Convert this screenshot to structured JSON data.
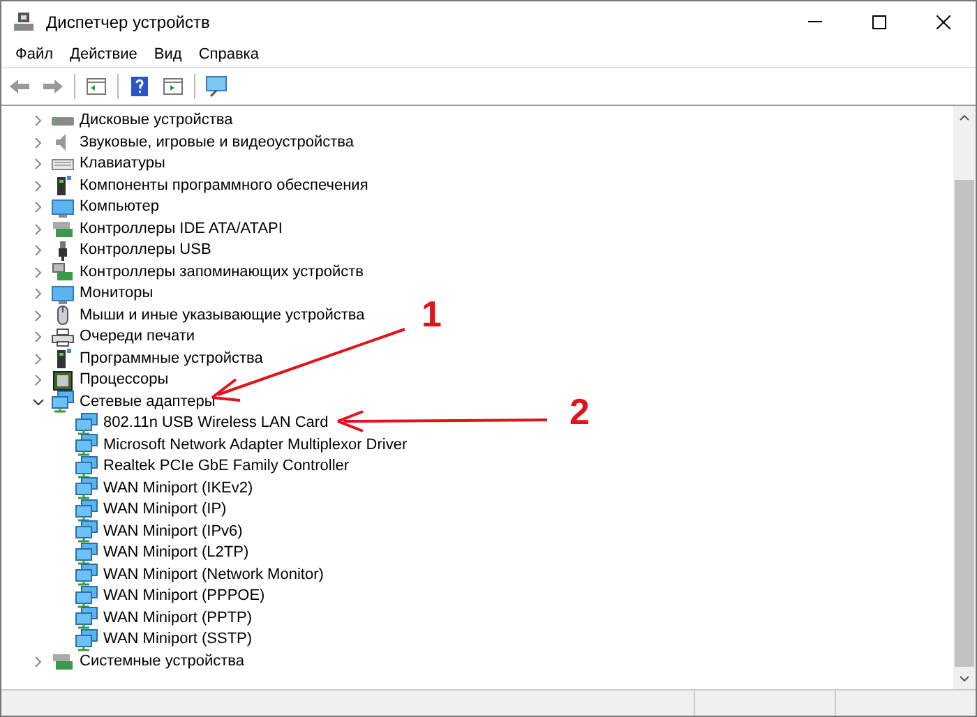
{
  "window": {
    "title": "Диспетчер устройств"
  },
  "menu": [
    "Файл",
    "Действие",
    "Вид",
    "Справка"
  ],
  "tree": [
    {
      "label": "Дисковые устройства",
      "kind": "disk",
      "expanded": false
    },
    {
      "label": "Звуковые, игровые и видеоустройства",
      "kind": "sound",
      "expanded": false
    },
    {
      "label": "Клавиатуры",
      "kind": "keyboard",
      "expanded": false
    },
    {
      "label": "Компоненты программного обеспечения",
      "kind": "software",
      "expanded": false
    },
    {
      "label": "Компьютер",
      "kind": "monitor",
      "expanded": false
    },
    {
      "label": "Контроллеры IDE ATA/ATAPI",
      "kind": "board",
      "expanded": false
    },
    {
      "label": "Контроллеры USB",
      "kind": "usb",
      "expanded": false
    },
    {
      "label": "Контроллеры запоминающих устройств",
      "kind": "storage",
      "expanded": false
    },
    {
      "label": "Мониторы",
      "kind": "monitor",
      "expanded": false
    },
    {
      "label": "Мыши и иные указывающие устройства",
      "kind": "mouse",
      "expanded": false
    },
    {
      "label": "Очереди печати",
      "kind": "printer",
      "expanded": false
    },
    {
      "label": "Программные устройства",
      "kind": "software",
      "expanded": false
    },
    {
      "label": "Процессоры",
      "kind": "cpu",
      "expanded": false
    },
    {
      "label": "Сетевые адаптеры",
      "kind": "network",
      "expanded": true,
      "children": [
        {
          "label": "802.11n USB Wireless LAN Card",
          "kind": "network"
        },
        {
          "label": "Microsoft Network Adapter Multiplexor Driver",
          "kind": "network"
        },
        {
          "label": "Realtek PCIe GbE Family Controller",
          "kind": "network"
        },
        {
          "label": "WAN Miniport (IKEv2)",
          "kind": "network"
        },
        {
          "label": "WAN Miniport (IP)",
          "kind": "network"
        },
        {
          "label": "WAN Miniport (IPv6)",
          "kind": "network"
        },
        {
          "label": "WAN Miniport (L2TP)",
          "kind": "network"
        },
        {
          "label": "WAN Miniport (Network Monitor)",
          "kind": "network"
        },
        {
          "label": "WAN Miniport (PPPOE)",
          "kind": "network"
        },
        {
          "label": "WAN Miniport (PPTP)",
          "kind": "network"
        },
        {
          "label": "WAN Miniport (SSTP)",
          "kind": "network"
        }
      ]
    },
    {
      "label": "Системные устройства",
      "kind": "board",
      "expanded": false
    }
  ],
  "annotations": [
    {
      "label": "1"
    },
    {
      "label": "2"
    }
  ]
}
